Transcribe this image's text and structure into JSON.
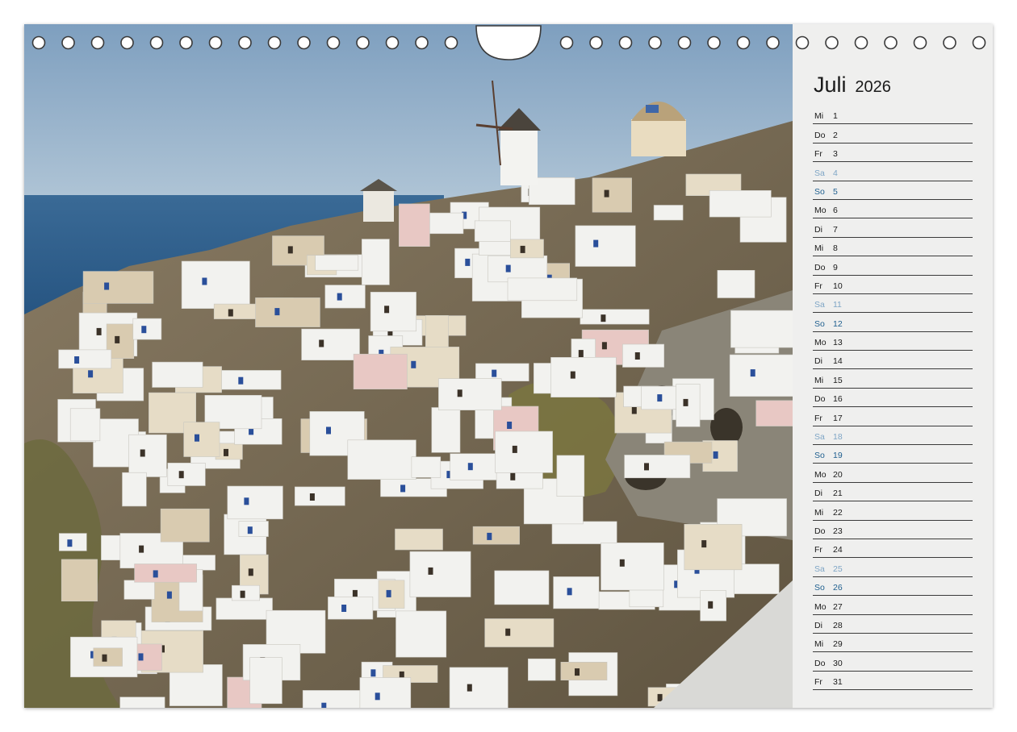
{
  "calendar": {
    "month": "Juli",
    "year": "2026",
    "days": [
      {
        "weekday": "Mi",
        "day": "1",
        "type": "weekday"
      },
      {
        "weekday": "Do",
        "day": "2",
        "type": "weekday"
      },
      {
        "weekday": "Fr",
        "day": "3",
        "type": "weekday"
      },
      {
        "weekday": "Sa",
        "day": "4",
        "type": "saturday"
      },
      {
        "weekday": "So",
        "day": "5",
        "type": "sunday"
      },
      {
        "weekday": "Mo",
        "day": "6",
        "type": "weekday"
      },
      {
        "weekday": "Di",
        "day": "7",
        "type": "weekday"
      },
      {
        "weekday": "Mi",
        "day": "8",
        "type": "weekday"
      },
      {
        "weekday": "Do",
        "day": "9",
        "type": "weekday"
      },
      {
        "weekday": "Fr",
        "day": "10",
        "type": "weekday"
      },
      {
        "weekday": "Sa",
        "day": "11",
        "type": "saturday"
      },
      {
        "weekday": "So",
        "day": "12",
        "type": "sunday"
      },
      {
        "weekday": "Mo",
        "day": "13",
        "type": "weekday"
      },
      {
        "weekday": "Di",
        "day": "14",
        "type": "weekday"
      },
      {
        "weekday": "Mi",
        "day": "15",
        "type": "weekday"
      },
      {
        "weekday": "Do",
        "day": "16",
        "type": "weekday"
      },
      {
        "weekday": "Fr",
        "day": "17",
        "type": "weekday"
      },
      {
        "weekday": "Sa",
        "day": "18",
        "type": "saturday"
      },
      {
        "weekday": "So",
        "day": "19",
        "type": "sunday"
      },
      {
        "weekday": "Mo",
        "day": "20",
        "type": "weekday"
      },
      {
        "weekday": "Di",
        "day": "21",
        "type": "weekday"
      },
      {
        "weekday": "Mi",
        "day": "22",
        "type": "weekday"
      },
      {
        "weekday": "Do",
        "day": "23",
        "type": "weekday"
      },
      {
        "weekday": "Fr",
        "day": "24",
        "type": "weekday"
      },
      {
        "weekday": "Sa",
        "day": "25",
        "type": "saturday"
      },
      {
        "weekday": "So",
        "day": "26",
        "type": "sunday"
      },
      {
        "weekday": "Mo",
        "day": "27",
        "type": "weekday"
      },
      {
        "weekday": "Di",
        "day": "28",
        "type": "weekday"
      },
      {
        "weekday": "Mi",
        "day": "29",
        "type": "weekday"
      },
      {
        "weekday": "Do",
        "day": "30",
        "type": "weekday"
      },
      {
        "weekday": "Fr",
        "day": "31",
        "type": "weekday"
      }
    ]
  },
  "photo": {
    "subject": "white-village-cliffside-icon",
    "colors": {
      "sky": "#8fb0cc",
      "sea": "#2f5f8e",
      "house": "#f1f1ee",
      "accent": "#2a4f9a"
    }
  },
  "binding": {
    "ring_icon": "binder-ring-icon",
    "notch_icon": "hanger-notch-icon"
  }
}
